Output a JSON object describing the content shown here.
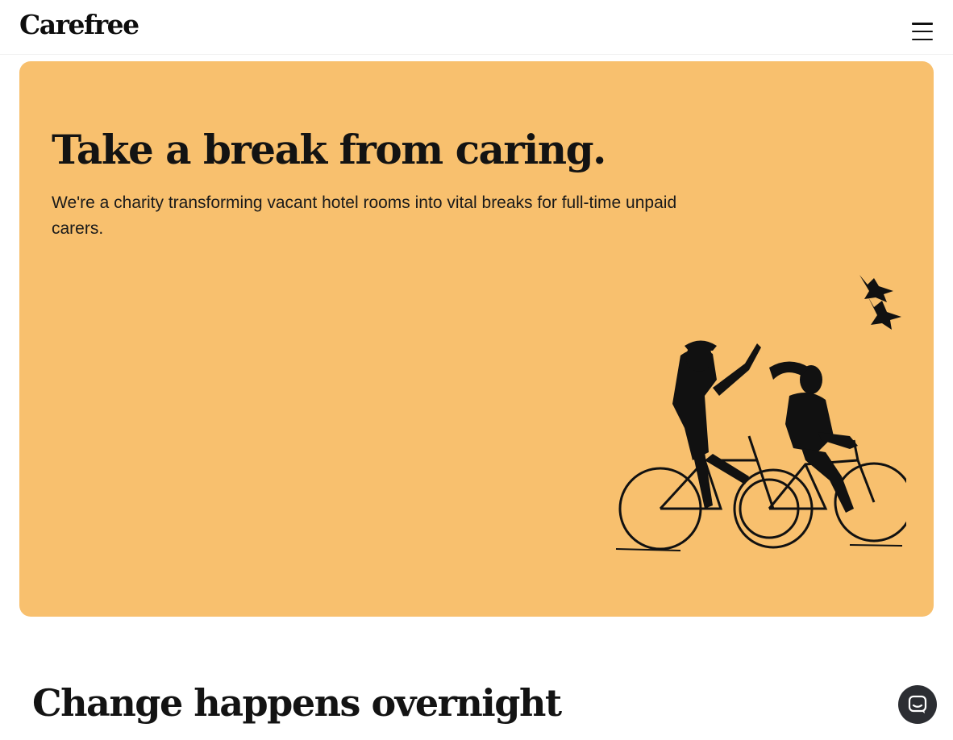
{
  "header": {
    "logo_text": "Carefree",
    "menu_icon": "hamburger-menu-icon"
  },
  "hero": {
    "title": "Take a break from caring.",
    "subtitle": "We're a charity transforming vacant hotel rooms into vital breaks for full-time unpaid carers.",
    "background_color": "#f8c06e",
    "illustration": "two-people-riding-bicycles-with-birds"
  },
  "section": {
    "title": "Change happens overnight"
  },
  "chat": {
    "icon": "chat-icon",
    "color": "#2c2e33"
  }
}
